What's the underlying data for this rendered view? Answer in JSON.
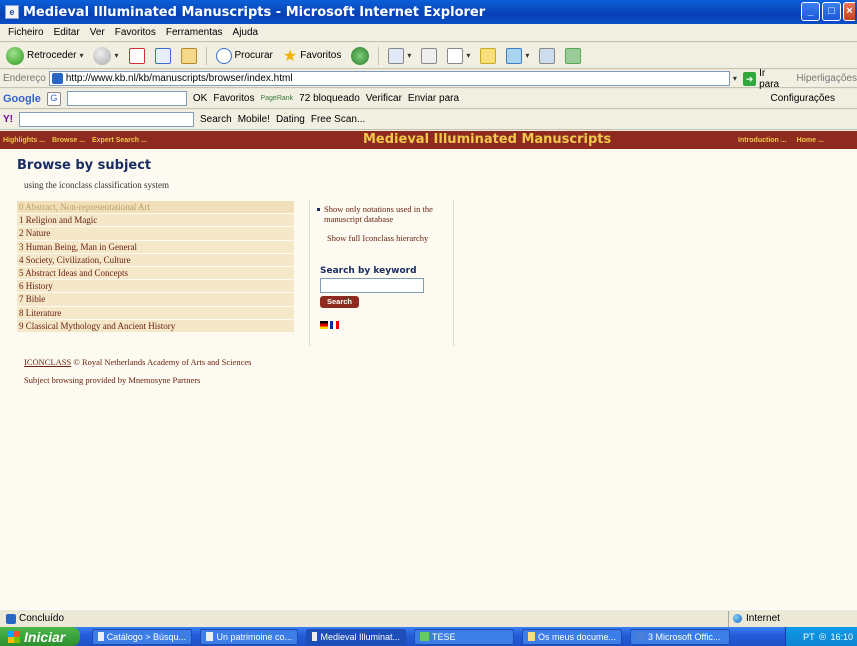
{
  "window": {
    "title": "Medieval Illuminated Manuscripts - Microsoft Internet Explorer",
    "controls": [
      "minimize",
      "maximize",
      "close"
    ]
  },
  "menu": [
    "Ficheiro",
    "Editar",
    "Ver",
    "Favoritos",
    "Ferramentas",
    "Ajuda"
  ],
  "toolbar": {
    "back_label": "Retroceder",
    "search_label": "Procurar",
    "favorites_label": "Favoritos"
  },
  "address": {
    "label": "Endereço",
    "url": "http://www.kb.nl/kb/manuscripts/browser/index.html",
    "go_label": "Ir para",
    "links_label": "Hiperligações"
  },
  "google_bar": {
    "logo": "Google",
    "g_button": "G",
    "ok_label": "OK",
    "favorites": "Favoritos",
    "pagerank": "PageRank",
    "blocked": "72 bloqueado",
    "check": "Verificar",
    "send": "Enviar para",
    "settings": "Configurações"
  },
  "yahoo_bar": {
    "search_label": "Search",
    "mobile": "Mobile!",
    "dating": "Dating",
    "freescan": "Free Scan..."
  },
  "site": {
    "nav_left": [
      "Highlights ...",
      "Browse ...",
      "Expert Search ..."
    ],
    "title": "Medieval Illuminated Manuscripts",
    "nav_right": [
      "Introduction ...",
      "Home ..."
    ]
  },
  "page": {
    "heading": "Browse by subject",
    "subtitle": "using the iconclass classification system",
    "subjects": [
      "0 Abstract, Non-representational Art",
      "1 Religion and Magic",
      "2 Nature",
      "3 Human Being, Man in General",
      "4 Society, Civilization, Culture",
      "5 Abstract Ideas and Concepts",
      "6 History",
      "7 Bible",
      "8 Literature",
      "9 Classical Mythology and Ancient History"
    ],
    "option_notations": "Show only notations used in the manuscript database",
    "option_hierarchy": "Show full Iconclass hierarchy",
    "keyword_label": "Search by keyword",
    "keyword_value": "",
    "search_button": "Search",
    "credit_link": "ICONCLASS",
    "credit_rest": "© Royal Netherlands Academy of Arts and Sciences",
    "credit2": "Subject browsing provided by Mnemosyne Partners"
  },
  "status": {
    "text": "Concluído",
    "zone": "Internet"
  },
  "taskbar": {
    "start": "Iniciar",
    "tasks": [
      "Catálogo > Búsqu...",
      "Un patrimoine co...",
      "Medieval Illuminat...",
      "TESE",
      "Os meus docume...",
      "3 Microsoft Offic..."
    ],
    "tray_lang": "PT",
    "tray_time": "16:10"
  },
  "colors": {
    "site_header": "#8e2a1f",
    "site_title": "#f0c84a",
    "heading": "#1a2d63",
    "link": "#6a2010",
    "list_bg": "#f5e8c8"
  }
}
